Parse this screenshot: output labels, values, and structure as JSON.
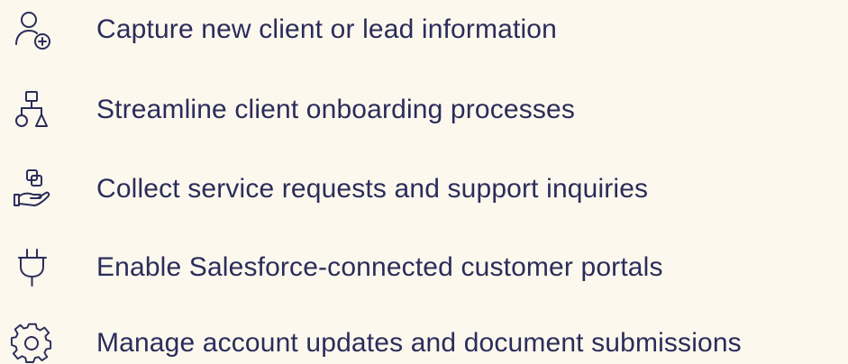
{
  "colors": {
    "background": "#fdf8ee",
    "text": "#2a2d5a",
    "icon": "#2a2d5a"
  },
  "features": [
    {
      "icon": "user-plus-icon",
      "label": "Capture new client or lead information"
    },
    {
      "icon": "hierarchy-icon",
      "label": "Streamline client onboarding processes"
    },
    {
      "icon": "hand-boxes-icon",
      "label": "Collect service requests and support inquiries"
    },
    {
      "icon": "plug-icon",
      "label": "Enable Salesforce-connected customer portals"
    },
    {
      "icon": "gear-icon",
      "label": "Manage account updates and document submissions"
    }
  ]
}
